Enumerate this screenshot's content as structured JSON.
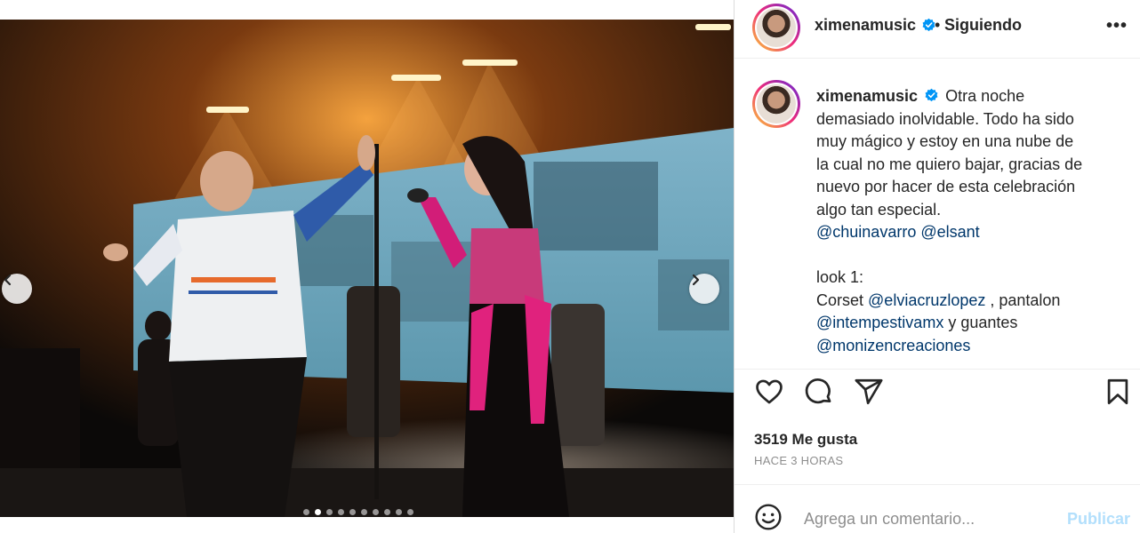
{
  "post": {
    "username": "ximenamusic",
    "bullet": "•",
    "following_label": "Siguiendo",
    "more_label": "•••",
    "caption_lines": [
      "Otra noche",
      "demasiado inolvidable. Todo ha sido",
      "muy mágico y estoy en una nube de",
      "la cual no me quiero bajar, gracias de",
      "nuevo por hacer de esta celebración",
      "algo tan especial."
    ],
    "mentions_line": {
      "m1": "@chuinavarro",
      "m2": "@elsant"
    },
    "look_title": "look 1:",
    "corset_label": "Corset",
    "corset_mention": "@elviacruzlopez",
    "pantalon_label": ", pantalon",
    "pantalon_mention": "@intempestivamx",
    "guantes_label": "y guantes",
    "guantes_mention": "@monizencreaciones",
    "likes": "3519 Me gusta",
    "time": "HACE 3 HORAS",
    "comment_placeholder": "Agrega un comentario...",
    "publish_label": "Publicar"
  },
  "carousel": {
    "total_dots": 10,
    "active_index": 1
  },
  "colors": {
    "accent": "#0095f6",
    "verified": "#0095f6",
    "mention": "#00376b",
    "publish_disabled": "#b2dffc"
  },
  "icons": [
    "chevron-left-icon",
    "chevron-right-icon",
    "heart-icon",
    "comment-icon",
    "share-icon",
    "bookmark-icon",
    "emoji-icon",
    "verified-icon"
  ]
}
